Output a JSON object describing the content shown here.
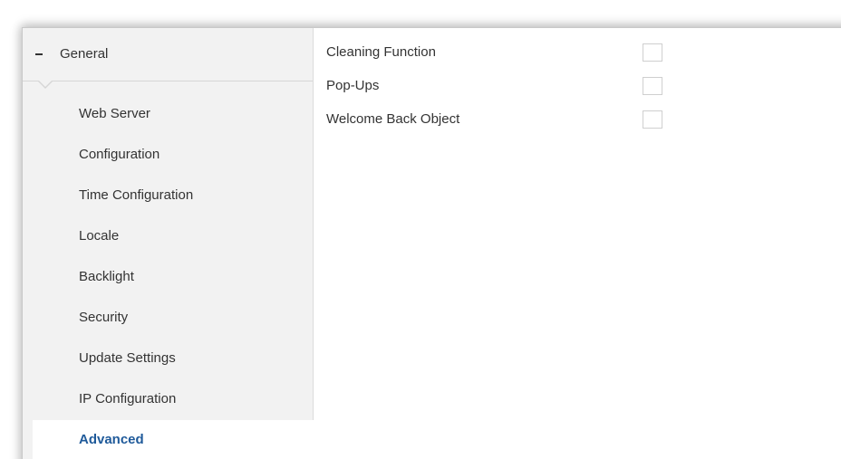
{
  "sidebar": {
    "group": {
      "label": "General",
      "icon": "minus-icon",
      "expanded": true
    },
    "items": [
      {
        "label": "Web Server",
        "active": false
      },
      {
        "label": "Configuration",
        "active": false
      },
      {
        "label": "Time Configuration",
        "active": false
      },
      {
        "label": "Locale",
        "active": false
      },
      {
        "label": "Backlight",
        "active": false
      },
      {
        "label": "Security",
        "active": false
      },
      {
        "label": "Update Settings",
        "active": false
      },
      {
        "label": "IP Configuration",
        "active": false
      },
      {
        "label": "Advanced",
        "active": true
      }
    ]
  },
  "main": {
    "options": [
      {
        "label": "Cleaning Function",
        "checked": false
      },
      {
        "label": "Pop-Ups",
        "checked": false
      },
      {
        "label": "Welcome Back Object",
        "checked": false
      }
    ]
  },
  "colors": {
    "sidebar_bg": "#f2f2f2",
    "active_text": "#1f5a9a",
    "text": "#333333"
  }
}
